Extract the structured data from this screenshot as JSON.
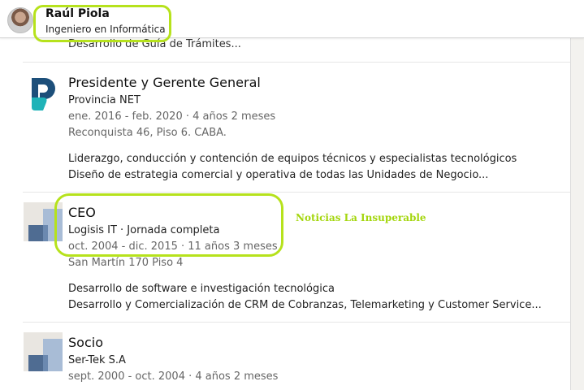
{
  "header": {
    "name": "Raúl Piola",
    "headline": "Ingeniero en Informática"
  },
  "partial_line": "Desarrollo de Guía de Trámites...",
  "experience": [
    {
      "title": "Presidente y Gerente General",
      "company": "Provincia NET",
      "dates": "ene. 2016 - feb. 2020 · 4 años 2 meses",
      "location": "Reconquista 46, Piso 6. CABA.",
      "description": [
        "Liderazgo, conducción y contención de equipos técnicos y especialistas tecnológicos",
        "Diseño de estrategia comercial y operativa de todas las Unidades de Negocio..."
      ]
    },
    {
      "title": "CEO",
      "company": "Logisis IT · Jornada completa",
      "dates": "oct. 2004 - dic. 2015 · 11 años 3 meses",
      "location": "San Martín 170 Piso 4",
      "description": [
        "Desarrollo de software e investigación tecnológica",
        "Desarrollo y Comercialización de CRM de Cobranzas, Telemarketing y Customer Service..."
      ]
    },
    {
      "title": "Socio",
      "company": "Ser-Tek S.A",
      "dates": "sept. 2000 - oct. 2004 · 4 años 2 meses"
    }
  ],
  "watermark": "Noticias La Insuperable",
  "colors": {
    "highlight": "#b6e21c",
    "watermark": "#a4d60e",
    "provincia_logo_dark": "#1d4f7a",
    "provincia_logo_teal": "#1fb3b8"
  }
}
